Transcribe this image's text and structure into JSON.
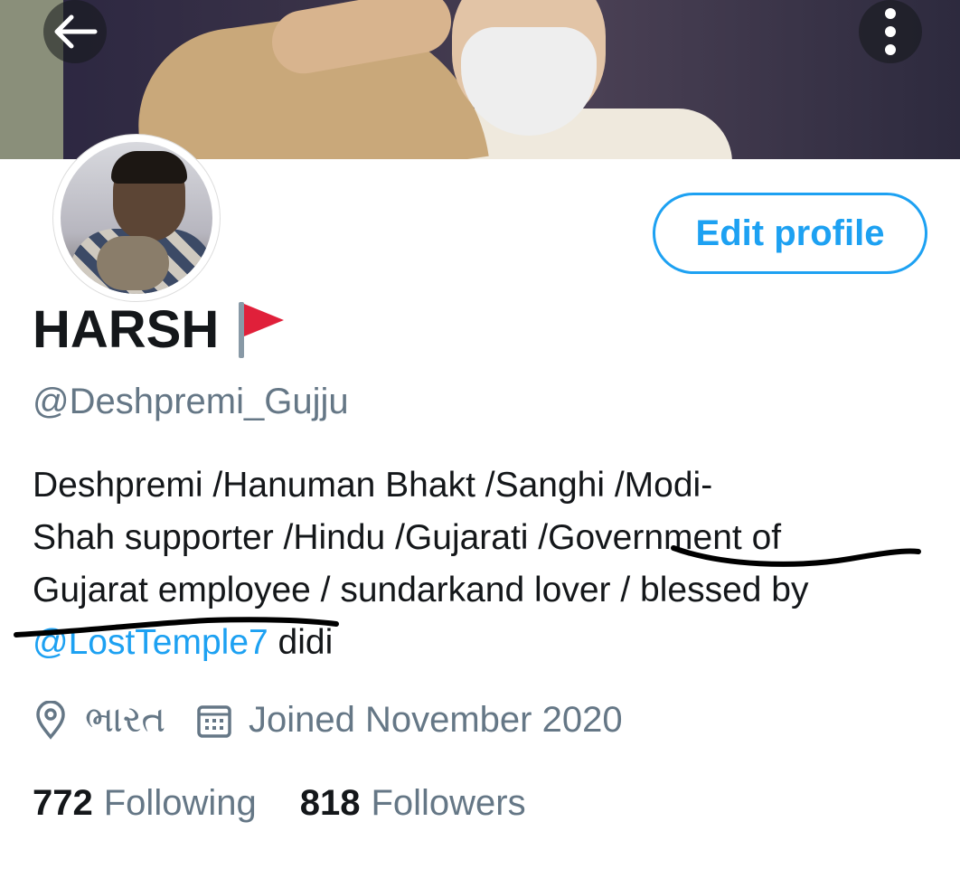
{
  "colors": {
    "accent": "#1da1f2",
    "text": "#14171a",
    "secondary": "#657786"
  },
  "header": {
    "back_icon": "arrow-left-icon",
    "more_icon": "more-vertical-icon"
  },
  "profile": {
    "name": "HARSH",
    "name_icon": "red-flag-icon",
    "handle": "@Deshpremi_Gujju",
    "edit_button": "Edit profile",
    "bio": {
      "line1": "Deshpremi /Hanuman Bhakt /Sanghi /Modi-",
      "line2": "Shah supporter /Hindu /Gujarati /Government of",
      "line3": "Gujarat employee / sundarkand lover / blessed by",
      "mention": "@LostTemple7",
      "line4_rest": " didi"
    },
    "location": "ભારત",
    "location_icon": "location-pin-icon",
    "joined": "Joined November 2020",
    "joined_icon": "calendar-icon",
    "following_count": "772",
    "following_label": "Following",
    "followers_count": "818",
    "followers_label": "Followers"
  }
}
